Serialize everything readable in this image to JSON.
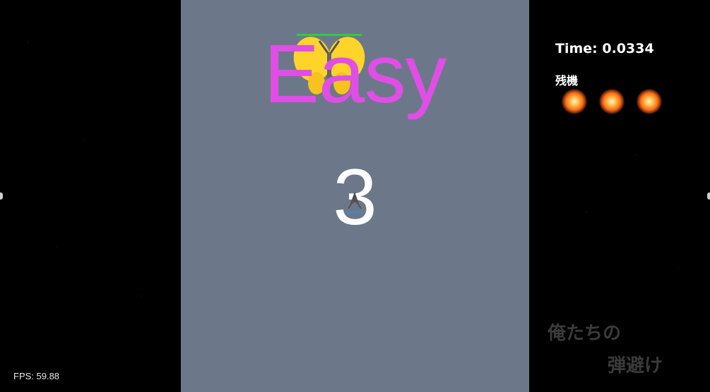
{
  "playfield": {
    "difficulty_label": "Easy",
    "countdown": "3",
    "boss_icon": "butterfly-icon",
    "player_icon": "ship-icon"
  },
  "hud": {
    "time_label": "Time: 0.0334",
    "lives_label": "残機",
    "lives_count": 3,
    "life_icon": "fireball-icon"
  },
  "logo": {
    "line1": "俺たちの",
    "line2": "弾避け"
  },
  "fps_label": "FPS: 59.88",
  "colors": {
    "playfield_bg": "#6c788a",
    "difficulty_text": "#e04ee6",
    "countdown_text": "#ffffff",
    "boss_wing": "#ffd42a",
    "boss_health_bar": "#2ecc40",
    "player_bar": "#2f8ce0"
  }
}
